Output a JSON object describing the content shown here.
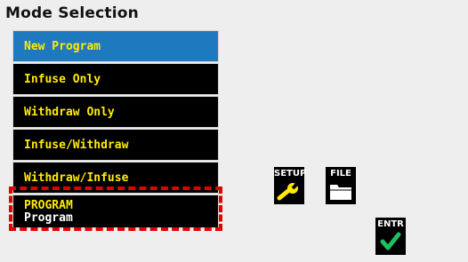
{
  "page_title": "Mode Selection",
  "menu": {
    "items": [
      {
        "label": "New Program",
        "selected": true
      },
      {
        "label": "Infuse Only"
      },
      {
        "label": "Withdraw Only"
      },
      {
        "label": "Infuse/Withdraw"
      },
      {
        "label": "Withdraw/Infuse"
      }
    ],
    "program": {
      "label": "PROGRAM",
      "value": "Program"
    }
  },
  "softkeys": {
    "setup": {
      "label": "SETUP",
      "icon": "wrench-icon",
      "icon_color": "#ffeb00"
    },
    "file": {
      "label": "FILE",
      "icon": "folder-icon",
      "icon_color": "#ffffff"
    },
    "enter": {
      "label": "ENTR",
      "icon": "checkmark-icon",
      "icon_color": "#1fbf60"
    }
  },
  "colors": {
    "selected_bg": "#1f79bf",
    "item_text": "#ffeb00",
    "highlight_box": "#e00000"
  }
}
